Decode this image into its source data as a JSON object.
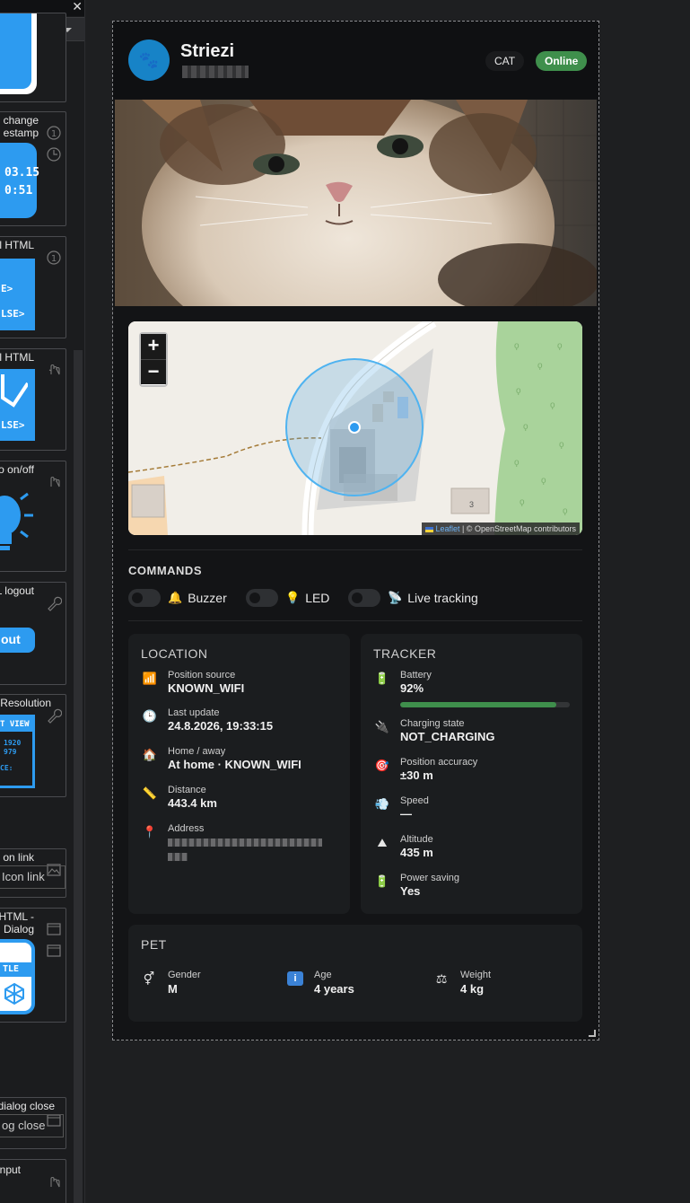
{
  "editor": {
    "widgets": [
      {
        "label": ""
      },
      {
        "label": "change\nestamp",
        "tile_lines": [
          "03.15",
          "0:51"
        ]
      },
      {
        "label": "l HTML",
        "tile_lines": [
          "E>",
          "LSE>"
        ]
      },
      {
        "label": "l HTML",
        "tile_lines": [
          "LSE>"
        ]
      },
      {
        "label": "o on/off"
      },
      {
        "label": "L logout",
        "tile_lines": [
          "out"
        ]
      },
      {
        "label": "Resolution",
        "tile_lines": [
          "T VIEW",
          "1920",
          "979",
          "CE:"
        ]
      },
      {
        "label": "on link",
        "tile_lines": [
          "Icon link"
        ]
      },
      {
        "label": "er - HTML -\njqui Dialog",
        "tile_lines": [
          "TLE"
        ]
      },
      {
        "label": "dialog close",
        "tile_lines": [
          "og close"
        ]
      },
      {
        "label": "nput"
      }
    ]
  },
  "header": {
    "name": "Striezi",
    "type_badge": "CAT",
    "status_badge": "Online"
  },
  "map": {
    "attribution_leaflet": "Leaflet",
    "attribution_rest": " | © OpenStreetMap contributors",
    "zoom_in": "+",
    "zoom_out": "−",
    "house_number": "3"
  },
  "commands": {
    "title": "COMMANDS",
    "items": [
      {
        "label": "Buzzer",
        "enabled": false
      },
      {
        "label": "LED",
        "enabled": false
      },
      {
        "label": "Live tracking",
        "enabled": false
      }
    ]
  },
  "location": {
    "title": "LOCATION",
    "position_source": {
      "label": "Position source",
      "value": "KNOWN_WIFI"
    },
    "last_update": {
      "label": "Last update",
      "value": "24.8.2026, 19:33:15"
    },
    "home_away": {
      "label": "Home / away",
      "value": "At home · KNOWN_WIFI"
    },
    "distance": {
      "label": "Distance",
      "value": "443.4 km"
    },
    "address": {
      "label": "Address"
    }
  },
  "tracker": {
    "title": "TRACKER",
    "battery": {
      "label": "Battery",
      "value": "92%",
      "percent": 92
    },
    "charging": {
      "label": "Charging state",
      "value": "NOT_CHARGING"
    },
    "accuracy": {
      "label": "Position accuracy",
      "value": "±30 m"
    },
    "speed": {
      "label": "Speed",
      "value": "—"
    },
    "altitude": {
      "label": "Altitude",
      "value": "435 m"
    },
    "power_saving": {
      "label": "Power saving",
      "value": "Yes"
    }
  },
  "pet": {
    "title": "PET",
    "gender": {
      "label": "Gender",
      "value": "M"
    },
    "age": {
      "label": "Age",
      "value": "4 years"
    },
    "weight": {
      "label": "Weight",
      "value": "4 kg"
    }
  },
  "colors": {
    "accent_blue": "#2d9bf0",
    "online_green": "#3f8f4c",
    "avatar_blue": "#1783c7"
  }
}
